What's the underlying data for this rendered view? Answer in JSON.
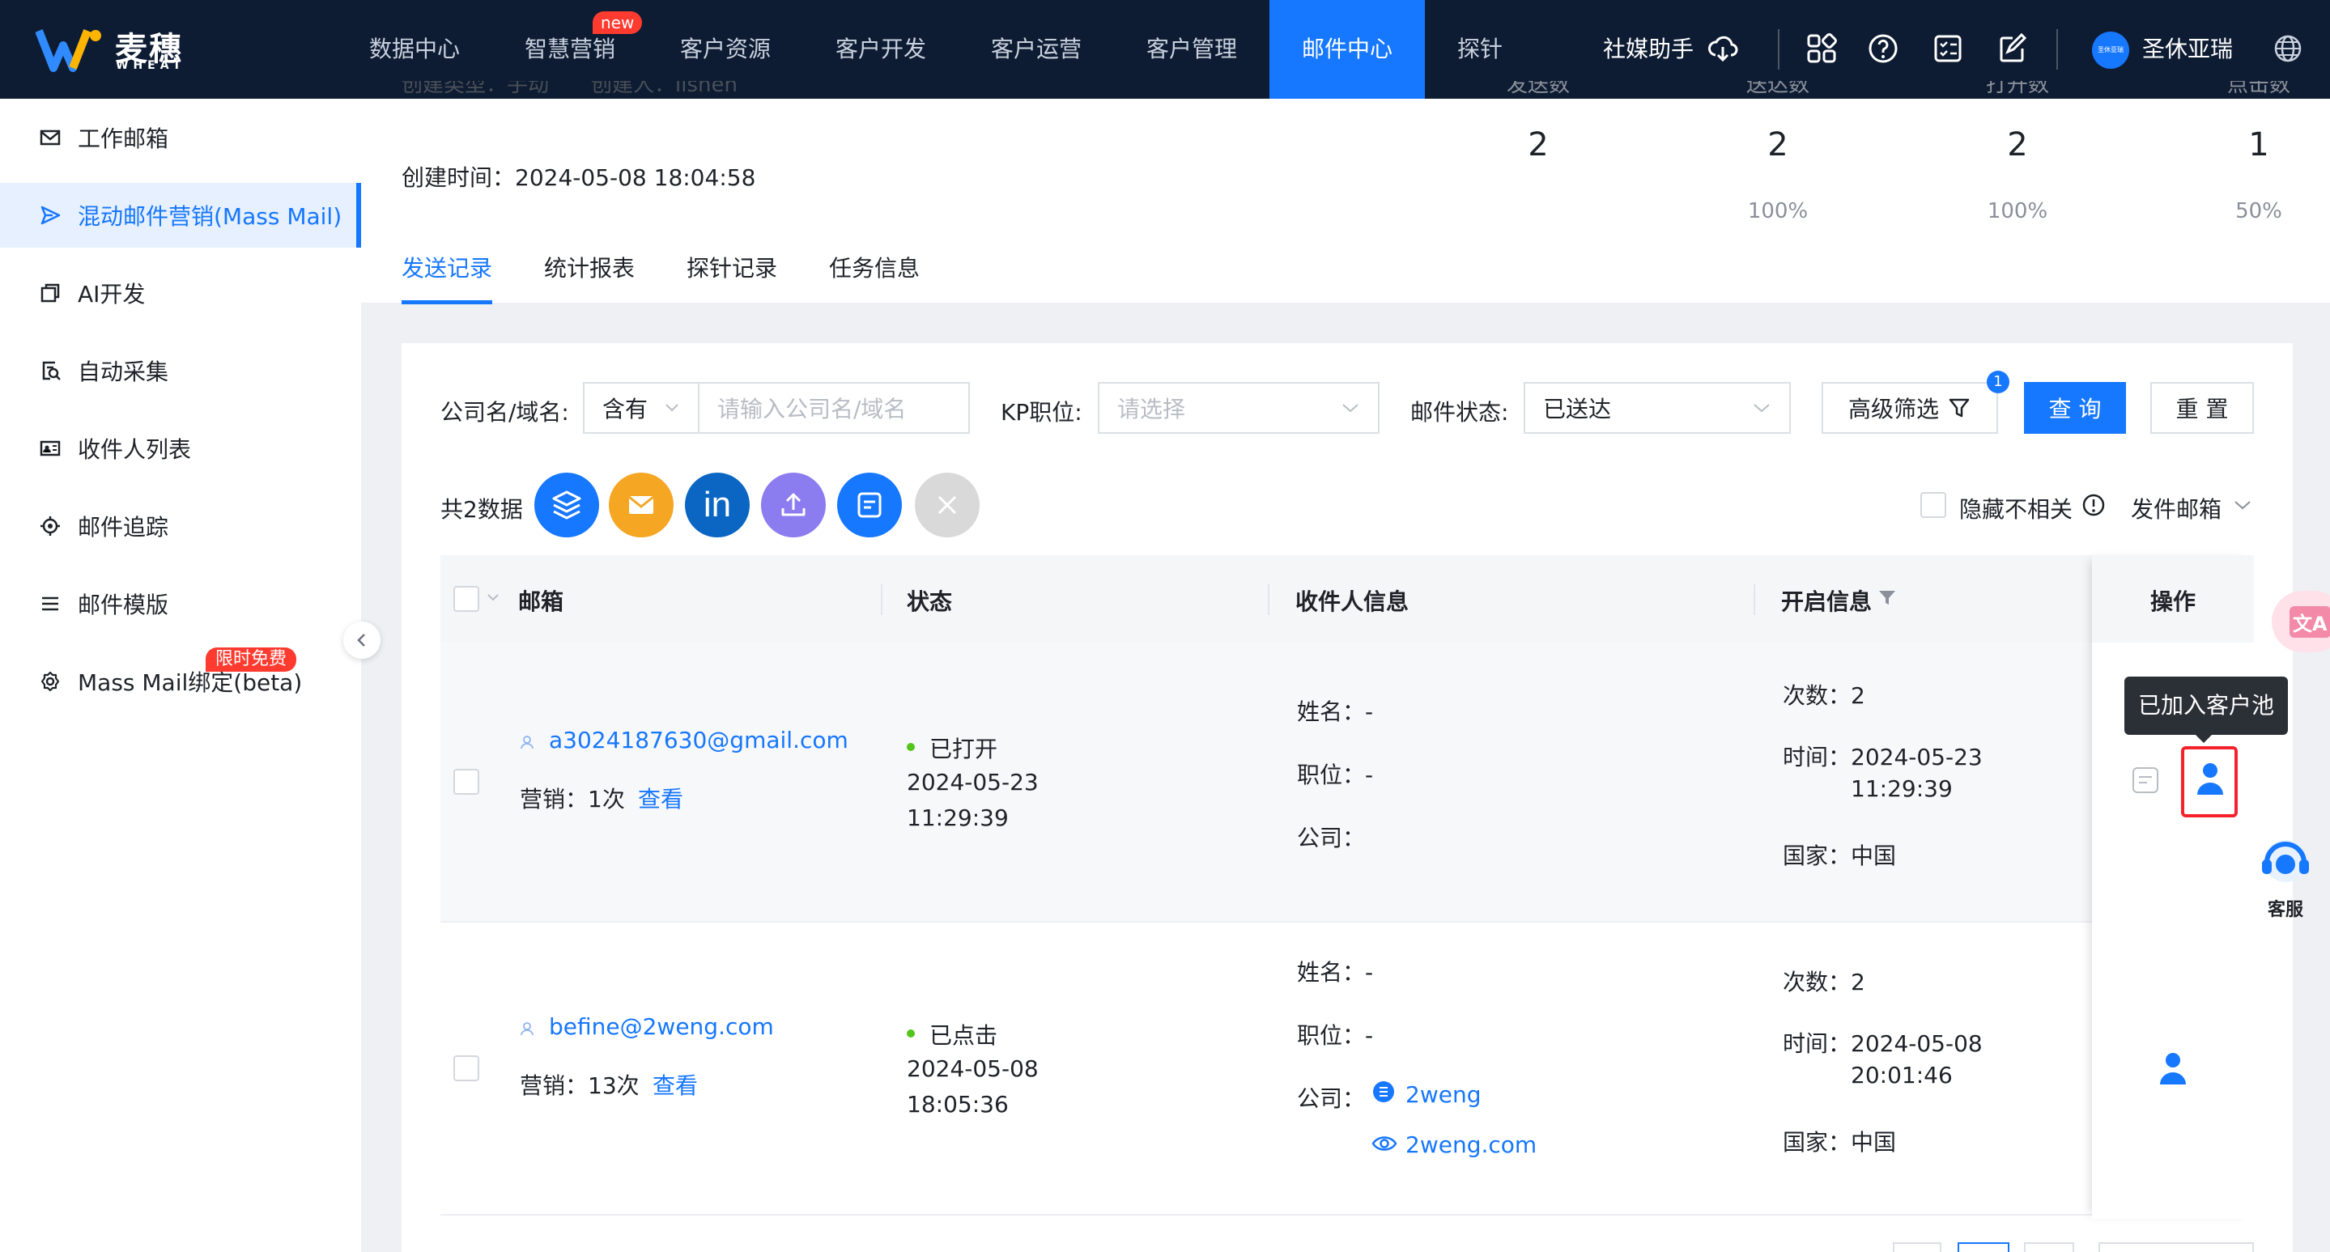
{
  "brand": {
    "name_cn": "麦穗",
    "name_en": "WHEAT"
  },
  "nav": {
    "items": [
      {
        "label": "数据中心"
      },
      {
        "label": "智慧营销",
        "badge": "new"
      },
      {
        "label": "客户资源"
      },
      {
        "label": "客户开发"
      },
      {
        "label": "客户运营"
      },
      {
        "label": "客户管理"
      },
      {
        "label": "邮件中心",
        "active": true
      },
      {
        "label": "探针"
      }
    ],
    "social_assistant": "社媒助手",
    "user_name": "圣休亚瑞",
    "avatar_text": "圣休亚瑞"
  },
  "sidebar": {
    "items": [
      {
        "label": "工作邮箱",
        "icon": "mail-icon"
      },
      {
        "label": "混动邮件营销(Mass Mail)",
        "icon": "send-icon",
        "active": true
      },
      {
        "label": "AI开发",
        "icon": "copy-icon"
      },
      {
        "label": "自动采集",
        "icon": "collect-icon"
      },
      {
        "label": "收件人列表",
        "icon": "contacts-icon"
      },
      {
        "label": "邮件追踪",
        "icon": "target-icon"
      },
      {
        "label": "邮件模版",
        "icon": "list-icon"
      },
      {
        "label": "Mass Mail绑定(beta)",
        "icon": "gear-icon",
        "badge": "限时免费"
      }
    ]
  },
  "task": {
    "cut_line": "创建类型：手动　　创建人：lishen",
    "created_time": "创建时间：2024-05-08 18:04:58",
    "stats": [
      {
        "label": "发送数",
        "value": "2",
        "pct": ""
      },
      {
        "label": "送达数",
        "value": "2",
        "pct": "100%"
      },
      {
        "label": "打开数",
        "value": "2",
        "pct": "100%"
      },
      {
        "label": "点击数",
        "value": "1",
        "pct": "50%"
      }
    ]
  },
  "tabs": [
    {
      "label": "发送记录",
      "active": true
    },
    {
      "label": "统计报表"
    },
    {
      "label": "探针记录"
    },
    {
      "label": "任务信息"
    }
  ],
  "filters": {
    "company_label": "公司名/域名:",
    "match_value": "含有",
    "company_placeholder": "请输入公司名/域名",
    "kp_label": "KP职位:",
    "kp_placeholder": "请选择",
    "status_label": "邮件状态:",
    "status_value": "已送达",
    "advanced_label": "高级筛选",
    "advanced_count": "1",
    "query_label": "查 询",
    "reset_label": "重 置"
  },
  "toolbar": {
    "total": "共2数据",
    "hide_irrelevant": "隐藏不相关",
    "send_mailbox": "发件邮箱"
  },
  "table": {
    "headers": {
      "email": "邮箱",
      "status": "状态",
      "recipient": "收件人信息",
      "open": "开启信息",
      "ops": "操作"
    },
    "rows": [
      {
        "email": "a3024187630@gmail.com",
        "marketing": "营销：1次",
        "view": "查看",
        "status": "已打开",
        "status_date": "2024-05-23",
        "status_time": "11:29:39",
        "name": "姓名：-",
        "position": "职位：-",
        "company": "公司：",
        "count": "次数：2",
        "time_date": "时间：2024-05-23",
        "time_clock": "11:29:39",
        "country": "国家：中国"
      },
      {
        "email": "befine@2weng.com",
        "marketing": "营销：13次",
        "view": "查看",
        "status": "已点击",
        "status_date": "2024-05-08",
        "status_time": "18:05:36",
        "name": "姓名：-",
        "position": "职位：-",
        "company": "公司：",
        "company_name": "2weng",
        "company_domain": "2weng.com",
        "count": "次数：2",
        "time_date": "时间：2024-05-08",
        "time_clock": "20:01:46",
        "country": "国家：中国"
      }
    ]
  },
  "tooltip": "已加入客户池",
  "customer_service": "客服",
  "translate_icon_text": "文A",
  "colors": {
    "primary": "#1677ff",
    "nav_bg": "#0e1c33",
    "badge_red": "#ff3b30",
    "success": "#52c41a"
  }
}
